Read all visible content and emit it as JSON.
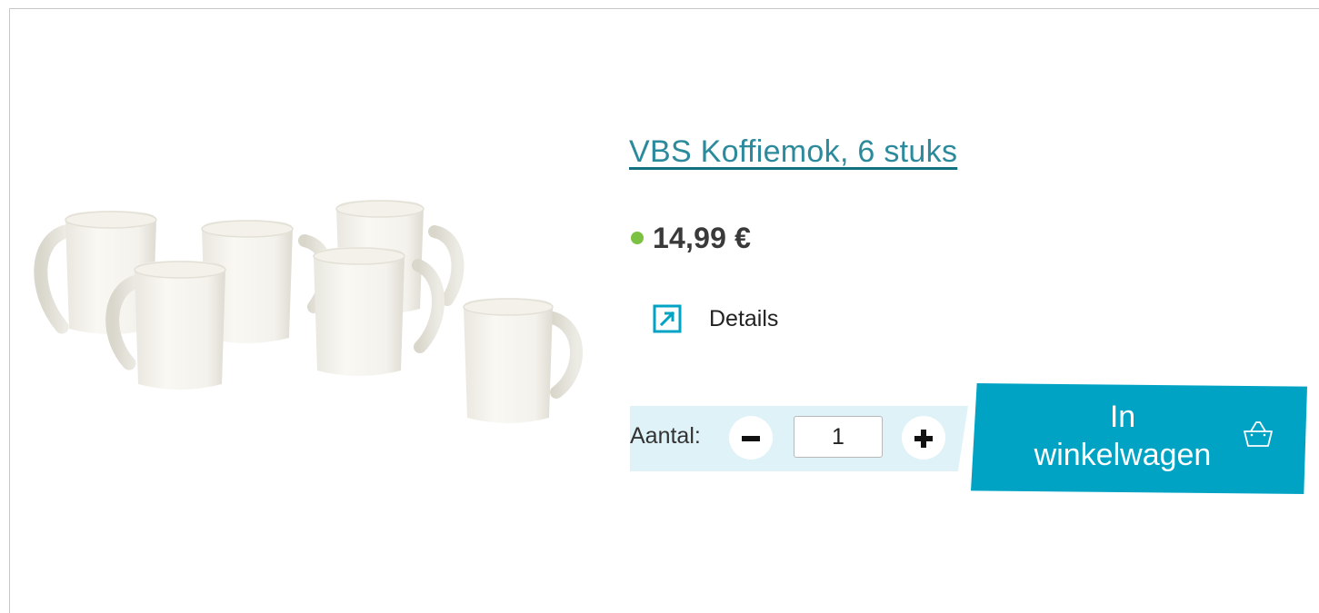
{
  "product": {
    "title": "VBS Koffiemok, 6 stuks",
    "price": "14,99 €",
    "availability_color": "#7cc242",
    "image_icon": "white-coffee-mugs-photo"
  },
  "details": {
    "label": "Details",
    "icon": "external-link-arrow-icon"
  },
  "quantity": {
    "label": "Aantal:",
    "value": "1",
    "minus_icon": "minus-icon",
    "plus_icon": "plus-icon"
  },
  "cart_button": {
    "line1": "In",
    "line2": "winkelwagen",
    "icon": "basket-icon",
    "color": "#00a3c4"
  },
  "colors": {
    "title": "#2b8a9c",
    "accent": "#00a3c4",
    "panel": "#dff2f7"
  }
}
